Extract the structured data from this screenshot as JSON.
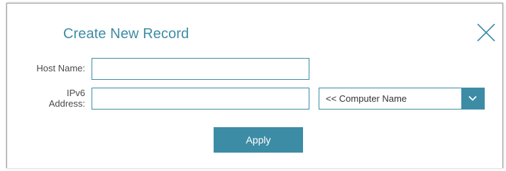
{
  "dialog": {
    "title": "Create New Record"
  },
  "form": {
    "host_name_label": "Host Name:",
    "host_name_value": "",
    "ipv6_label_line1": "IPv6",
    "ipv6_label_line2": "Address:",
    "ipv6_value": "",
    "computer_select_value": "<< Computer Name",
    "apply_label": "Apply"
  },
  "colors": {
    "accent": "#3d8ca5",
    "label_text": "#4a4a4a"
  },
  "icons": {
    "close": "close-icon",
    "dropdown": "chevron-down-icon"
  }
}
